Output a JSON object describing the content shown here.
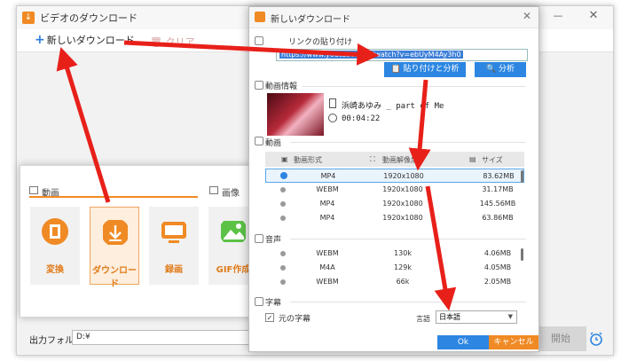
{
  "colors": {
    "accent": "#f08a24",
    "blue": "#2c86e2",
    "arrow": "#e8201a"
  },
  "main": {
    "title": "ビデオのダウンロード",
    "minimize": "—",
    "close": "✕",
    "toolbar": {
      "new_download": "新しいダウンロード",
      "clear": "クリア"
    },
    "output_label": "出力フォルダ：",
    "output_path": "D:¥",
    "start": "開始"
  },
  "launcher": {
    "video_section": "動画",
    "image_section": "画像",
    "tiles": [
      {
        "label": "変換",
        "icon": "film-icon"
      },
      {
        "label": "ダウンロード",
        "icon": "download-icon"
      },
      {
        "label": "録画",
        "icon": "monitor-icon"
      },
      {
        "label": "GIF作成",
        "icon": "image-icon"
      }
    ]
  },
  "dialog": {
    "title": "新しいダウンロード",
    "close": "✕",
    "paste_section": "リンクの貼り付け",
    "url": "https://www.youtube.com/watch?v=ebUyM4Ay3h0",
    "paste_analyze": "貼り付けと分析",
    "analyze": "分析",
    "info_section": "動画情報",
    "video_title": "浜崎あゆみ _ part of Me",
    "duration": "00:04:22",
    "video_section": "動画",
    "video_headers": {
      "format": "動画形式",
      "resolution": "動画解像度",
      "size": "サイズ"
    },
    "video_rows": [
      {
        "format": "MP4",
        "resolution": "1920x1080",
        "size": "83.62MB",
        "selected": true
      },
      {
        "format": "WEBM",
        "resolution": "1920x1080",
        "size": "31.17MB",
        "selected": false
      },
      {
        "format": "MP4",
        "resolution": "1920x1080",
        "size": "145.56MB",
        "selected": false
      },
      {
        "format": "MP4",
        "resolution": "1920x1080",
        "size": "63.86MB",
        "selected": false
      }
    ],
    "audio_section": "音声",
    "audio_rows": [
      {
        "format": "WEBM",
        "bitrate": "130k",
        "size": "4.06MB"
      },
      {
        "format": "M4A",
        "bitrate": "129k",
        "size": "4.05MB"
      },
      {
        "format": "WEBM",
        "bitrate": "66k",
        "size": "2.05MB"
      }
    ],
    "subtitle_section": "字幕",
    "original_subs": "元の字幕",
    "language_label": "言語",
    "language_value": "日本語",
    "ok": "Ok",
    "cancel": "キャンセル"
  }
}
